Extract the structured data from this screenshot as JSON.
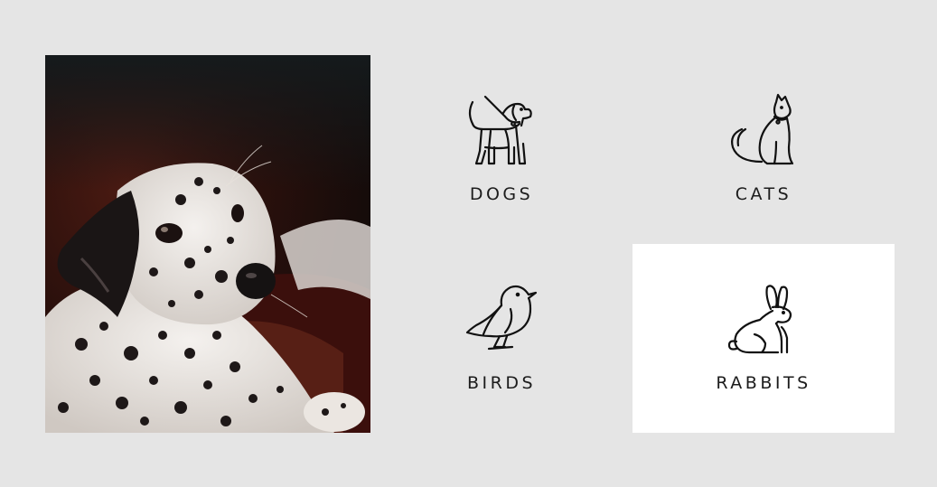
{
  "photo": {
    "icon": "dalmatian-puppy-photo"
  },
  "categories": [
    {
      "label": "DOGS",
      "icon": "dog-icon",
      "active": false
    },
    {
      "label": "CATS",
      "icon": "cat-icon",
      "active": false
    },
    {
      "label": "BIRDS",
      "icon": "bird-icon",
      "active": false
    },
    {
      "label": "RABBITS",
      "icon": "rabbit-icon",
      "active": true
    }
  ],
  "colors": {
    "background": "#e5e5e5",
    "active_tile": "#ffffff",
    "text": "#1c1c1c",
    "icon_stroke": "#111111"
  }
}
